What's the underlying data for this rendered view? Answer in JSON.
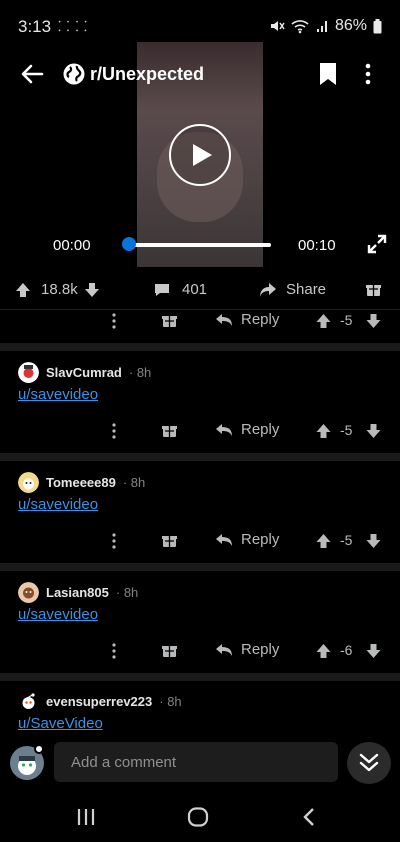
{
  "status_bar": {
    "time": "3:13",
    "extra_icons": "⸬ ⸬",
    "battery": "86%"
  },
  "header": {
    "subreddit": "r/Unexpected"
  },
  "video": {
    "current_time": "00:00",
    "duration": "00:10",
    "progress": 0.0
  },
  "post_actions": {
    "votes": "18.8k",
    "comments": "401",
    "share_label": "Share"
  },
  "top_comment_actions": {
    "reply_label": "Reply",
    "score": "-5"
  },
  "comments": [
    {
      "author": "SlavCumrad",
      "age": "· 8h",
      "text": "u/savevideo",
      "reply_label": "Reply",
      "score": "-5"
    },
    {
      "author": "Tomeeee89",
      "age": "· 8h",
      "text": "u/savevideo",
      "reply_label": "Reply",
      "score": "-5"
    },
    {
      "author": "Lasian805",
      "age": "· 8h",
      "text": "u/savevideo",
      "reply_label": "Reply",
      "score": "-6"
    },
    {
      "author": "evensuperrev223",
      "age": "· 8h",
      "text": "u/SaveVideo"
    }
  ],
  "composer": {
    "placeholder": "Add a comment"
  },
  "colors": {
    "link": "#3d91e6",
    "accent": "#0a74d9",
    "background": "#000000"
  }
}
